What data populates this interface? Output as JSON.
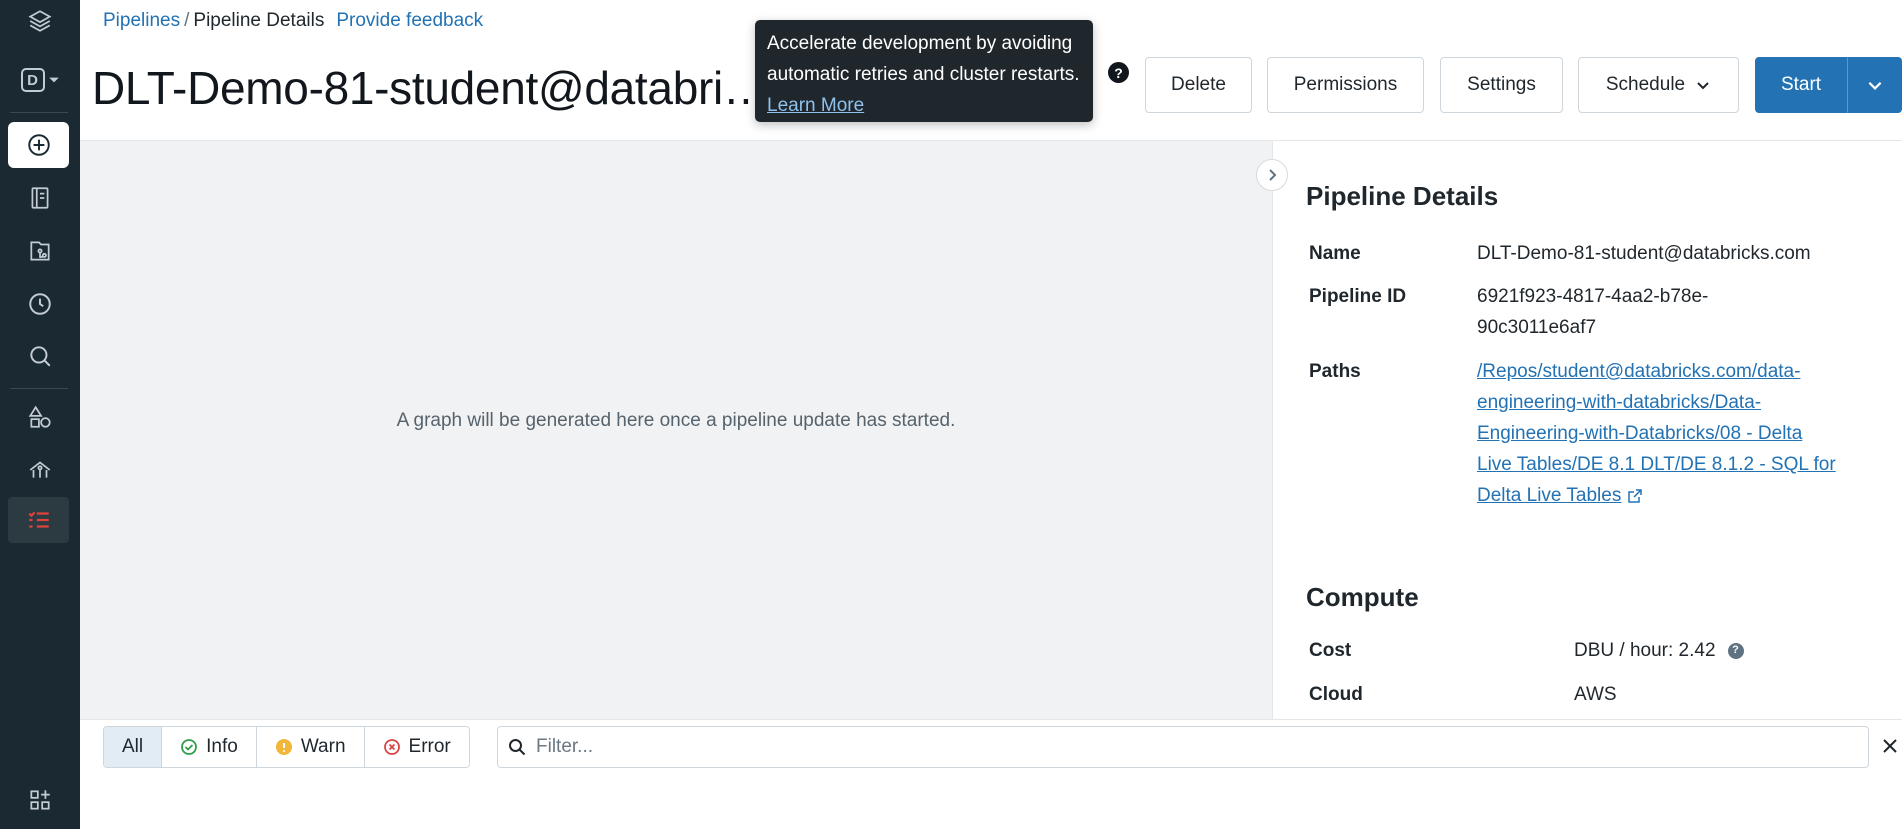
{
  "sidebar": {
    "items": [
      {
        "name": "logo-stack-icon"
      },
      {
        "name": "workspace-switcher-icon",
        "label": "D"
      },
      {
        "name": "create-icon"
      },
      {
        "name": "workspace-icon"
      },
      {
        "name": "repos-icon"
      },
      {
        "name": "recents-icon"
      },
      {
        "name": "search-icon"
      },
      {
        "name": "data-icon"
      },
      {
        "name": "compute-icon"
      },
      {
        "name": "workflows-icon"
      },
      {
        "name": "partner-connect-icon"
      }
    ]
  },
  "breadcrumb": {
    "parent": "Pipelines",
    "separator": "/",
    "current": "Pipeline Details",
    "feedback": "Provide feedback"
  },
  "header": {
    "title": "DLT-Demo-81-student@databri…",
    "help_glyph": "?"
  },
  "tooltip": {
    "text": "Accelerate development by avoiding automatic retries and cluster restarts.",
    "link": "Learn More"
  },
  "toolbar": {
    "delete": "Delete",
    "permissions": "Permissions",
    "settings": "Settings",
    "schedule": "Schedule",
    "start": "Start"
  },
  "graph": {
    "empty_message": "A graph will be generated here once a pipeline update has started."
  },
  "details": {
    "title": "Pipeline Details",
    "name_label": "Name",
    "name_value": "DLT-Demo-81-student@databricks.com",
    "id_label": "Pipeline ID",
    "id_value_line1": "6921f923-4817-4aa2-b78e-",
    "id_value_line2": "90c3011e6af7",
    "paths_label": "Paths",
    "path_lines": [
      "/Repos/student@databricks.com/data-",
      "engineering-with-databricks/Data-",
      "Engineering-with-Databricks/08 - Delta",
      "Live Tables/DE 8.1 DLT/DE 8.1.2 - SQL for",
      "Delta Live Tables"
    ]
  },
  "compute": {
    "title": "Compute",
    "cost_label": "Cost",
    "cost_value": "DBU / hour: 2.42",
    "cloud_label": "Cloud",
    "cloud_value": "AWS"
  },
  "log_filters": {
    "all": "All",
    "info": "Info",
    "warn": "Warn",
    "error": "Error",
    "search_placeholder": "Filter..."
  },
  "colors": {
    "sidebar_bg": "#1b2a32",
    "primary": "#2272b4",
    "info_green": "#2e9e48",
    "warn_yellow": "#f2b73a",
    "error_red": "#d64545"
  }
}
